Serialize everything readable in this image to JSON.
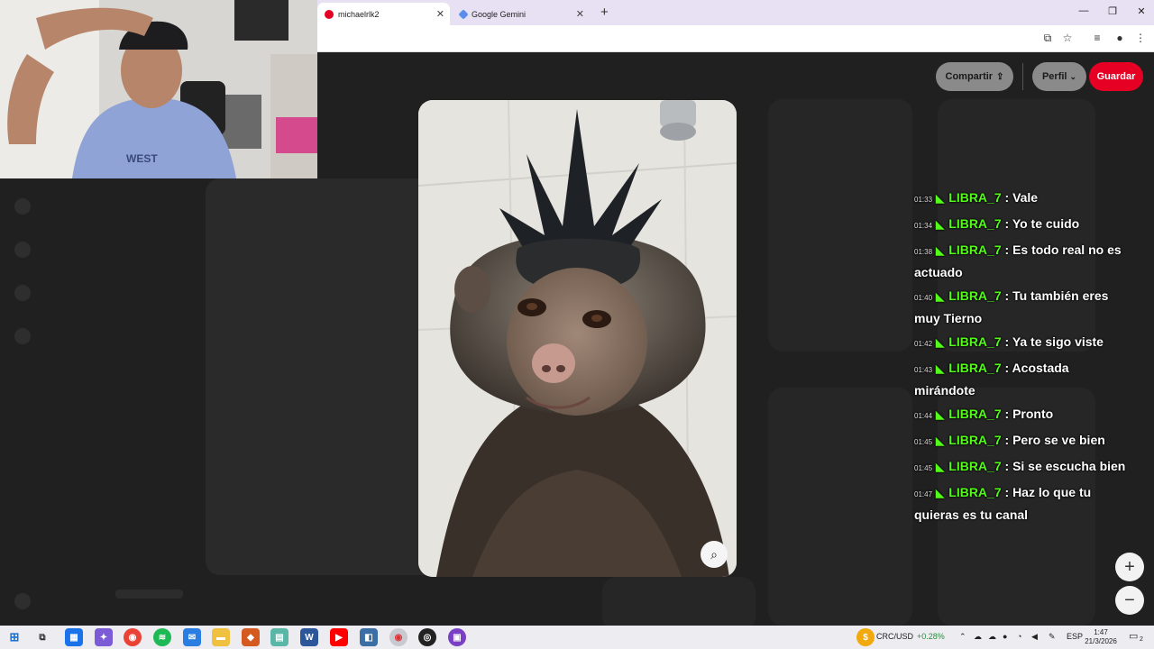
{
  "browser": {
    "tabs": [
      {
        "title": "michaelrlk2",
        "active": true
      },
      {
        "title": "Google Gemini",
        "active": false
      }
    ],
    "new_tab": "+"
  },
  "page": {
    "share_label": "Compartir",
    "profile_label": "Perfil",
    "save_label": "Guardar",
    "brand_color": "#e60023"
  },
  "chat": [
    {
      "time": "01:33",
      "user": "LIBRA_7",
      "text": ": Vale"
    },
    {
      "time": "01:34",
      "user": "LIBRA_7",
      "text": ": Yo te cuido"
    },
    {
      "time": "01:38",
      "user": "LIBRA_7",
      "text": ": Es todo real no es actuado"
    },
    {
      "time": "01:40",
      "user": "LIBRA_7",
      "text": ": Tu también eres muy Tierno"
    },
    {
      "time": "01:42",
      "user": "LIBRA_7",
      "text": ": Ya te sigo viste"
    },
    {
      "time": "01:43",
      "user": "LIBRA_7",
      "text": ": Acostada mirándote"
    },
    {
      "time": "01:44",
      "user": "LIBRA_7",
      "text": ": Pronto"
    },
    {
      "time": "01:45",
      "user": "LIBRA_7",
      "text": ": Pero se ve bien"
    },
    {
      "time": "01:45",
      "user": "LIBRA_7",
      "text": ": Si se escucha bien"
    },
    {
      "time": "01:47",
      "user": "LIBRA_7",
      "text": ": Haz lo que tu quieras es tu canal"
    }
  ],
  "taskbar": {
    "ticker_label": "CRC/USD",
    "ticker_change": "+0.28%",
    "language": "ESP",
    "time": "1:47",
    "date": "21/3/2026",
    "notifications": "2"
  }
}
